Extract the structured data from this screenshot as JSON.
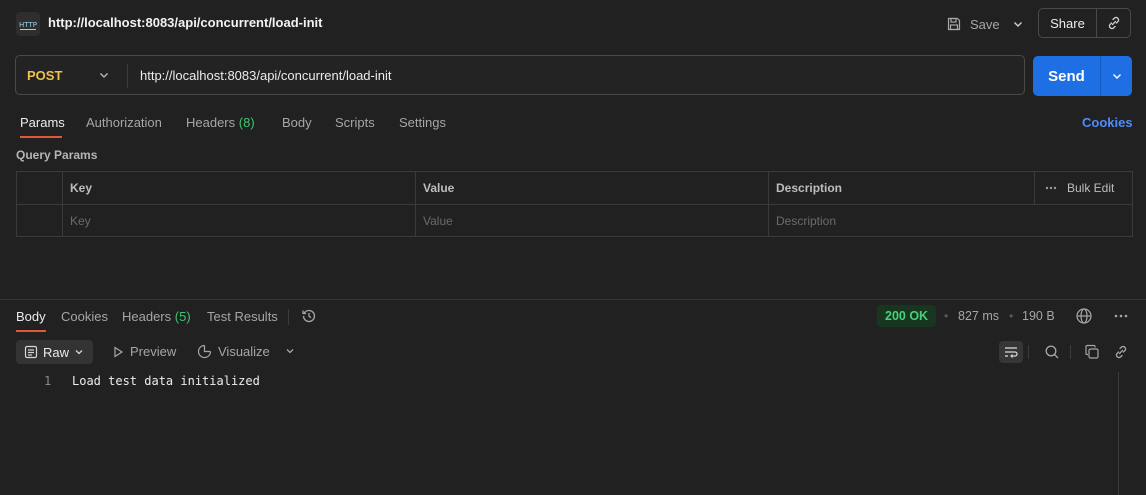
{
  "header": {
    "icon": "http-icon",
    "title": "http://localhost:8083/api/concurrent/load-init",
    "save_label": "Save",
    "share_label": "Share"
  },
  "request": {
    "method": "POST",
    "url": "http://localhost:8083/api/concurrent/load-init",
    "send_label": "Send"
  },
  "tabs": {
    "params": "Params",
    "authorization": "Authorization",
    "headers": "Headers",
    "headers_count": "(8)",
    "body": "Body",
    "scripts": "Scripts",
    "settings": "Settings",
    "cookies": "Cookies",
    "active": "Params"
  },
  "query_params": {
    "section_label": "Query Params",
    "columns": [
      "Key",
      "Value",
      "Description"
    ],
    "bulk_edit": "Bulk Edit",
    "placeholders": [
      "Key",
      "Value",
      "Description"
    ]
  },
  "response": {
    "tabs": {
      "body": "Body",
      "cookies": "Cookies",
      "headers": "Headers",
      "headers_count": "(5)",
      "test_results": "Test Results",
      "active": "Body"
    },
    "status": "200 OK",
    "time": "827 ms",
    "size": "190 B",
    "view": {
      "raw": "Raw",
      "preview": "Preview",
      "visualize": "Visualize"
    },
    "body_lines": [
      {
        "num": "1",
        "text": "Load test data initialized"
      }
    ]
  },
  "colors": {
    "accent": "#e0573a",
    "send": "#1f6fe4",
    "method": "#f0c24b",
    "success": "#47d17a",
    "link": "#4f8bff"
  }
}
